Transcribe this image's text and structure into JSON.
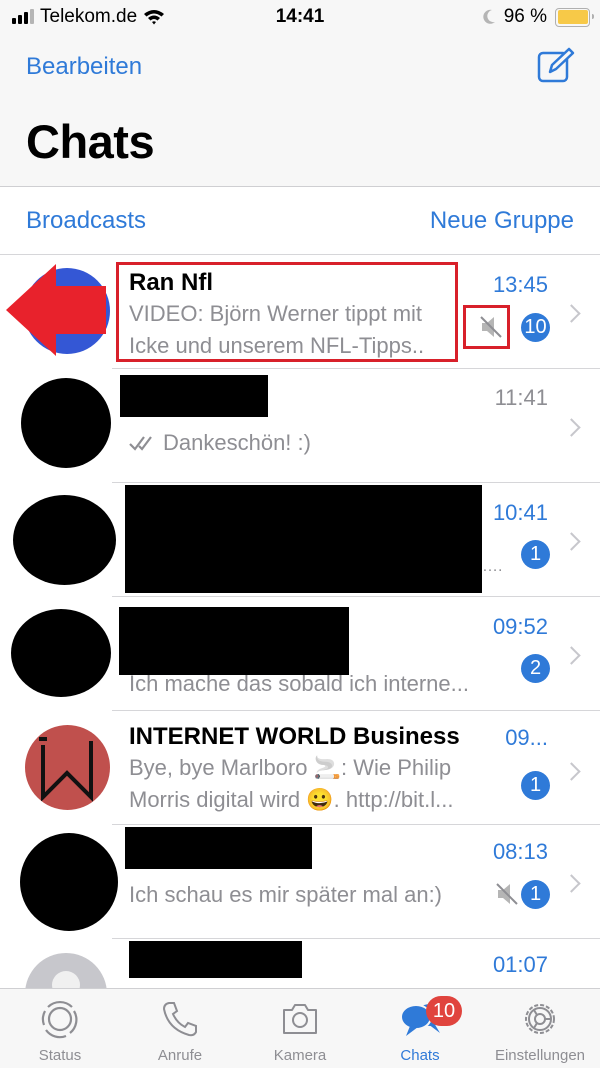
{
  "status_bar": {
    "carrier": "Telekom.de",
    "time": "14:41",
    "battery_percent": "96 %",
    "icons": [
      "signal-icon",
      "wifi-icon",
      "moon-icon",
      "battery-icon"
    ]
  },
  "nav": {
    "edit_label": "Bearbeiten",
    "title": "Chats",
    "compose_icon": "compose-icon"
  },
  "actions": {
    "broadcasts_label": "Broadcasts",
    "new_group_label": "Neue Gruppe"
  },
  "chats": [
    {
      "name": "Ran Nfl",
      "time": "13:45",
      "preview_line1": "VIDEO: Björn Werner tippt mit",
      "preview_line2": "Icke und unserem NFL-Tipps..",
      "muted": true,
      "unread": "10",
      "avatar_color": "#3457d5"
    },
    {
      "name": "",
      "name_redacted": true,
      "time": "11:41",
      "preview": "Dankeschön! :)",
      "read_receipt": "double-check-icon",
      "muted": false,
      "unread": ""
    },
    {
      "name": "",
      "name_redacted": true,
      "time": "10:41",
      "preview": "….",
      "muted": false,
      "unread": "1"
    },
    {
      "name": "",
      "name_redacted": true,
      "time": "09:52",
      "preview": "Ich mache das sobald ich interne...",
      "muted": false,
      "unread": "2"
    },
    {
      "name": "INTERNET WORLD Business",
      "time": "09...",
      "preview_line1": "Bye, bye Marlboro 🚬: Wie Philip",
      "preview_line2": "Morris digital wird 😀. http://bit.l...",
      "muted": false,
      "unread": "1",
      "avatar_color": "#c0504d"
    },
    {
      "name": "",
      "name_redacted": true,
      "time": "08:13",
      "preview": "Ich schau es mir später mal an:)",
      "muted": true,
      "unread": "1"
    },
    {
      "name": "",
      "name_redacted": true,
      "time": "01:07",
      "preview": "",
      "muted": false,
      "unread": ""
    }
  ],
  "tabbar": {
    "tabs": [
      {
        "label": "Status",
        "icon": "status-icon",
        "active": false
      },
      {
        "label": "Anrufe",
        "icon": "phone-icon",
        "active": false
      },
      {
        "label": "Kamera",
        "icon": "camera-icon",
        "active": false
      },
      {
        "label": "Chats",
        "icon": "chats-icon",
        "active": true,
        "badge": "10"
      },
      {
        "label": "Einstellungen",
        "icon": "settings-icon",
        "active": false
      }
    ]
  },
  "colors": {
    "accent": "#2f7ad8",
    "badge_red": "#e0443e",
    "annotation_red": "#d8202a"
  }
}
